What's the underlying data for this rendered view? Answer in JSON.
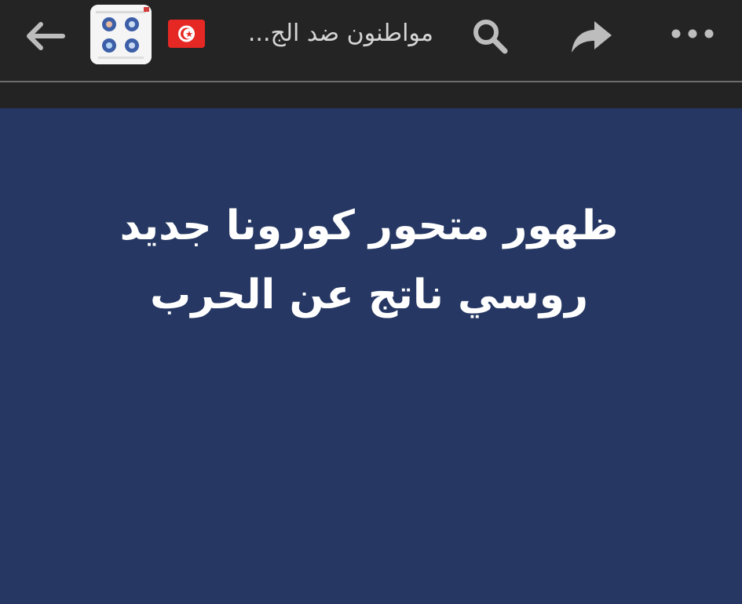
{
  "header": {
    "back_icon": "arrow-left-icon",
    "avatar_icon": "page-avatar-icon",
    "flag_icon": "tunisia-flag-icon",
    "title": "مواطنون ضد الج...",
    "search_icon": "search-icon",
    "share_icon": "share-icon",
    "more_icon": "more-icon"
  },
  "post": {
    "line1": "ظهور متحور كورونا جديد",
    "line2": "روسي ناتج عن الحرب"
  },
  "colors": {
    "topbar": "#242424",
    "post_background": "#253762",
    "text": "#ffffff",
    "icon": "#bdbdbd"
  }
}
